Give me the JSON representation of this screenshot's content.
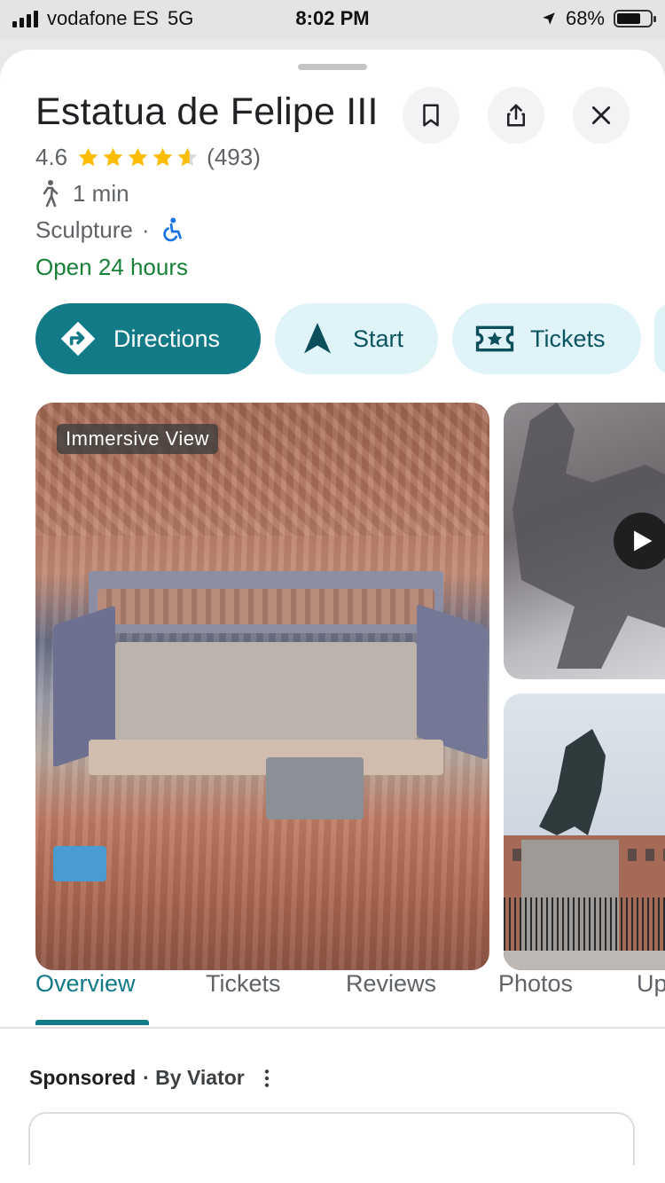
{
  "status_bar": {
    "carrier": "vodafone ES",
    "network": "5G",
    "time": "8:02 PM",
    "battery": "68%"
  },
  "place": {
    "title": "Estatua de Felipe III",
    "rating": "4.6",
    "rating_value": 4.6,
    "review_count": "(493)",
    "walk_time": "1 min",
    "category": "Sculpture",
    "category_sep": "·",
    "hours": "Open 24 hours"
  },
  "header_icons": [
    "bookmark-icon",
    "share-icon",
    "close-icon"
  ],
  "actions": {
    "directions": "Directions",
    "start": "Start",
    "tickets": "Tickets"
  },
  "photos": {
    "main_label": "Immersive View"
  },
  "tabs": [
    "Overview",
    "Tickets",
    "Reviews",
    "Photos",
    "Up"
  ],
  "sponsored": {
    "label": "Sponsored",
    "by": "· By Viator"
  },
  "colors": {
    "accent": "#137a87",
    "open_green": "#188038",
    "star": "#fbbc04",
    "chip_light": "#dff3f9"
  }
}
